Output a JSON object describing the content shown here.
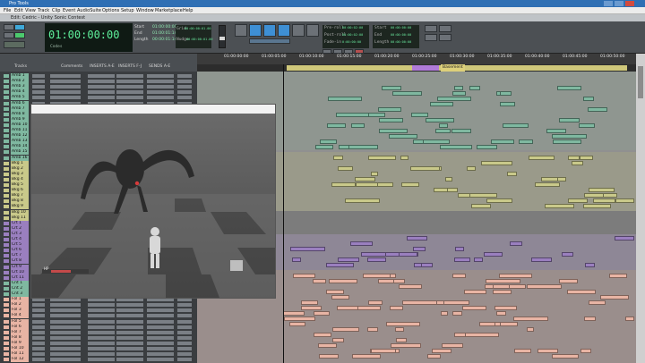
{
  "app": {
    "title": "Pro Tools",
    "document_title": "Edit: Cedric - Unity Sonic Contest"
  },
  "menu": [
    "File",
    "Edit",
    "View",
    "Track",
    "Clip",
    "Event",
    "AudioSuite",
    "Options",
    "Setup",
    "Window",
    "Marketplace",
    "Help"
  ],
  "toolbar": {
    "mode_buttons": [
      "Shuffle",
      "Slip",
      "Spot",
      "Grid"
    ],
    "main_counter": "01:00:00:00",
    "main_counter_label": "Codes",
    "sel_labels": [
      "Start",
      "End",
      "Length"
    ],
    "sel_values": [
      "01:00:00:00",
      "01:00:01:14",
      "00:00:01:14"
    ],
    "nudge_label": "Nudge",
    "grid_label": "Grid",
    "grid_value": "00:00:00:01.00",
    "nudge_value": "00:00:00:01.00",
    "pre_roll_labels": [
      "Pre-roll",
      "Post-roll",
      "Fade-in"
    ],
    "pre_roll_values": [
      "00:00:02:00",
      "00:00:02:00",
      "0:00:00:00"
    ],
    "counter2_labels": [
      "Start",
      "End",
      "Length"
    ],
    "counter2_values": [
      "00:00:00:00",
      "00:00:00:00",
      "00:00:00:00"
    ]
  },
  "ruler": {
    "ticks": [
      "01:00:00:00",
      "01:00:05:00",
      "01:00:10:00",
      "01:00:15:00",
      "01:00:20:00",
      "01:00:25:00",
      "01:00:30:00",
      "01:00:35:00",
      "01:00:40:00",
      "01:00:45:00",
      "01:00:50:00",
      "01:00:55:00"
    ],
    "marker": "Basement"
  },
  "mixer": {
    "headers": [
      "Tracks",
      "Comments",
      "INSERTS A-E",
      "INSERTS F-J",
      "SENDS A-E"
    ]
  },
  "tracks": {
    "names": [
      "Amb 1",
      "Amb 2",
      "Amb 3",
      "Amb 4",
      "Amb 5",
      "Amb 6",
      "Amb 7",
      "Amb 8",
      "Amb 9",
      "Amb 10",
      "Amb 11",
      "Amb 12",
      "Amb 13",
      "Amb 14",
      "Amb 15",
      "Amb 16",
      "Bkg 1",
      "Bkg 2",
      "Bkg 3",
      "Bkg 4",
      "Bkg 5",
      "Bkg 6",
      "Bkg 7",
      "Bkg 8",
      "Bkg 9",
      "Bkg 10",
      "Bkg 11",
      "Crt 1",
      "Crt 2",
      "Crt 3",
      "Crt 4",
      "Crt 5",
      "Crt 6",
      "Crt 7",
      "Crt 8",
      "Crt 9",
      "Crt 10",
      "Crt 11",
      "Cnt 1",
      "Cnt 2",
      "Cnt 3",
      "Fol 1",
      "Fol 2",
      "Fol 3",
      "Fol 4",
      "Fol 5",
      "Fol 6",
      "Fol 7",
      "Fol 8",
      "Fol 9",
      "Fol 10",
      "Fol 11",
      "Fol 12"
    ],
    "group_colors": {
      "amb": "#7fb8a0",
      "bkg": "#c9c98a",
      "crt": "#9a7fbf",
      "fol": "#e8b4a4"
    }
  },
  "video_window": {
    "title": "Video",
    "hud_label": "HP"
  }
}
